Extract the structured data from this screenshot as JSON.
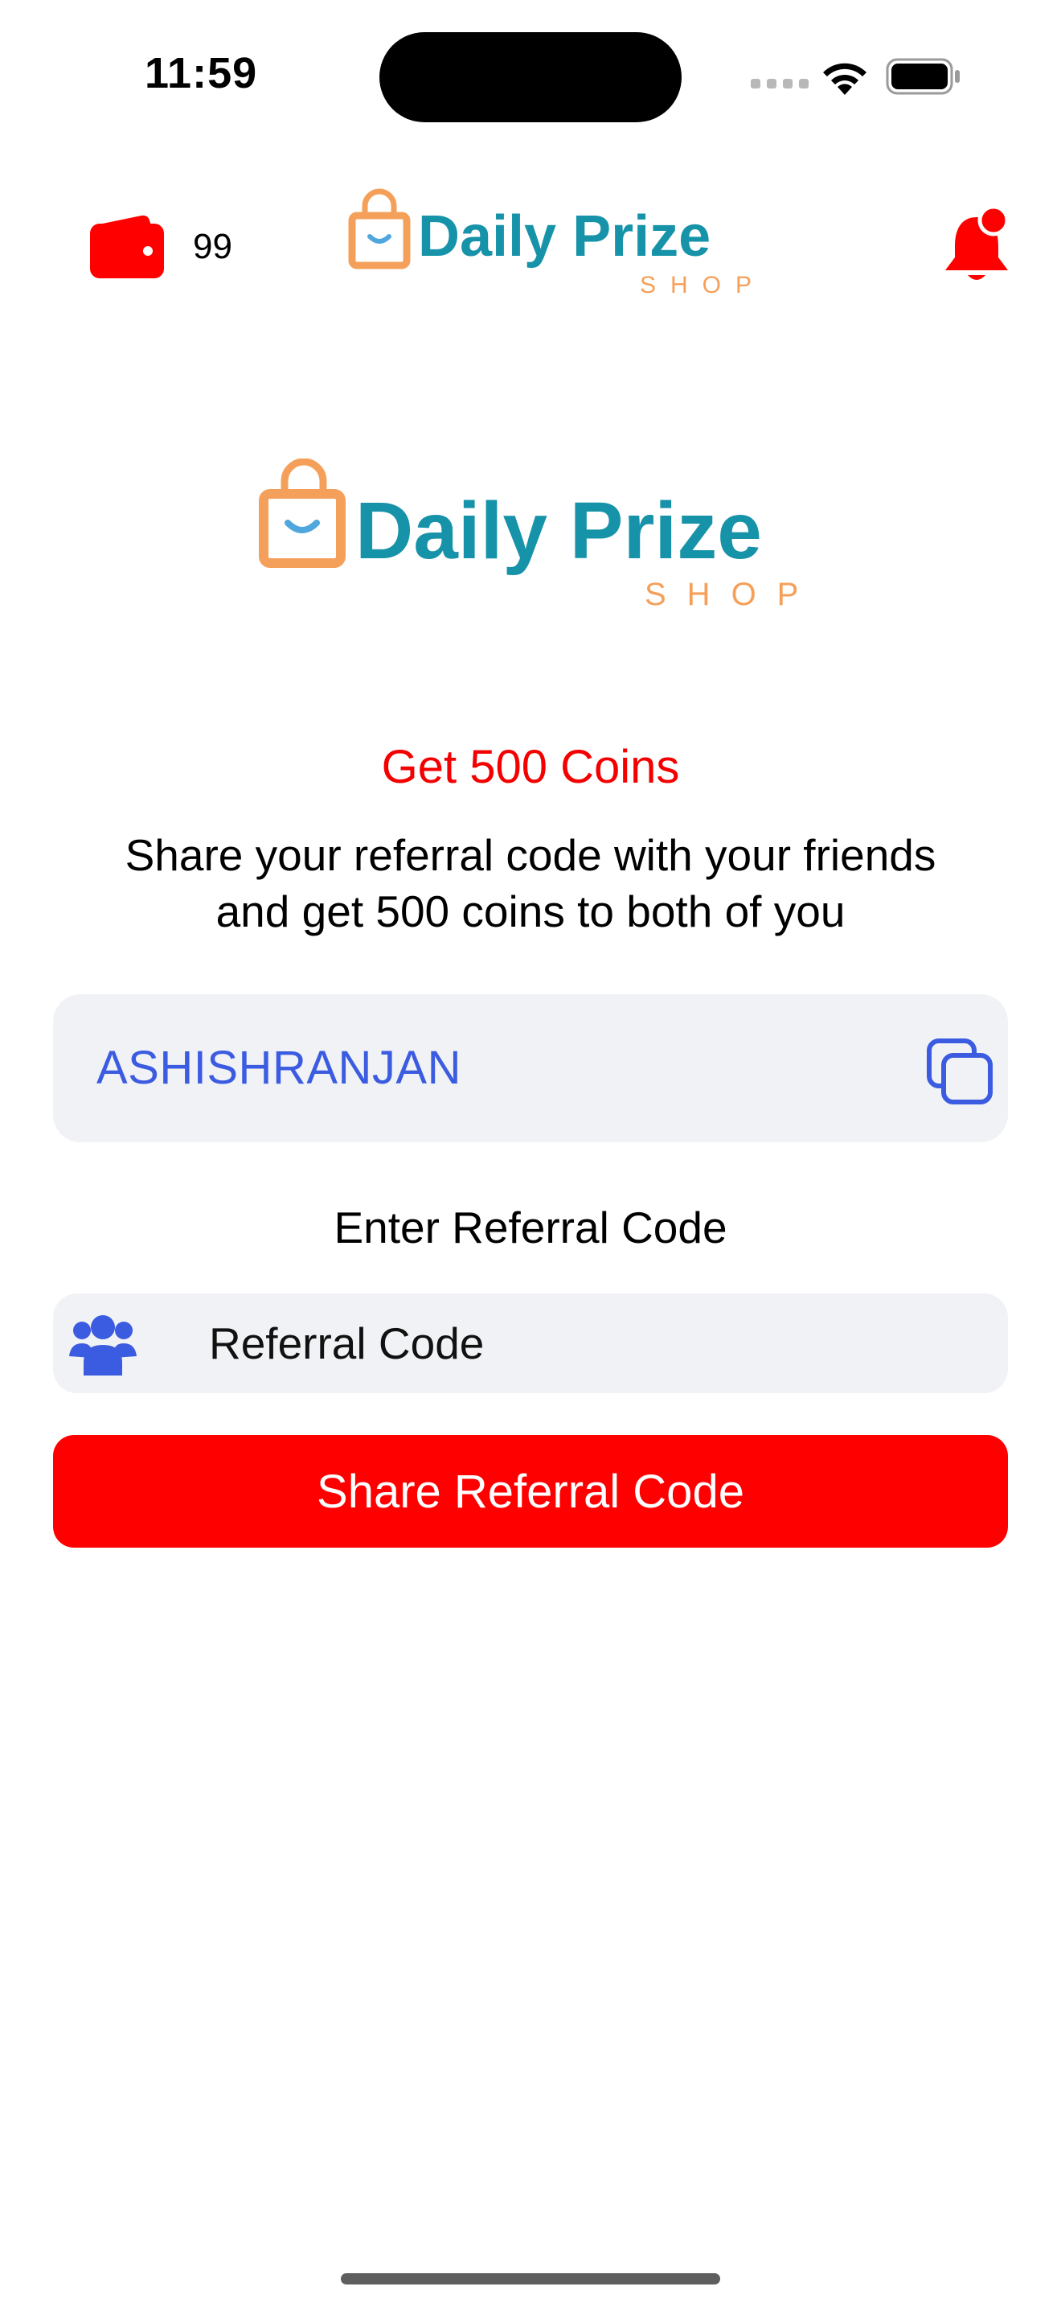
{
  "status_bar": {
    "time": "11:59"
  },
  "header": {
    "coin_balance": "99",
    "logo": {
      "brand": "Daily Prize",
      "sub": "SHOP"
    }
  },
  "hero_logo": {
    "brand": "Daily Prize",
    "sub": "SHOP"
  },
  "promo": {
    "title": "Get 500 Coins",
    "description_line1": "Share your referral code with your friends",
    "description_line2": "and get 500 coins to both of you"
  },
  "my_code": {
    "value": "ASHISHRANJAN"
  },
  "referral_entry": {
    "label": "Enter Referral Code",
    "placeholder": "Referral Code",
    "value": ""
  },
  "share_button": {
    "label": "Share Referral Code"
  },
  "colors": {
    "accent_red": "#ff0000",
    "promo_red": "#f40000",
    "link_blue": "#3b5ce0",
    "field_bg": "#f1f2f6",
    "logo_teal": "#1693a8",
    "logo_orange": "#f5a05a"
  },
  "icons": {
    "wallet": "wallet-icon",
    "bell": "notification-bell-icon",
    "copy": "copy-icon",
    "users": "users-group-icon"
  }
}
